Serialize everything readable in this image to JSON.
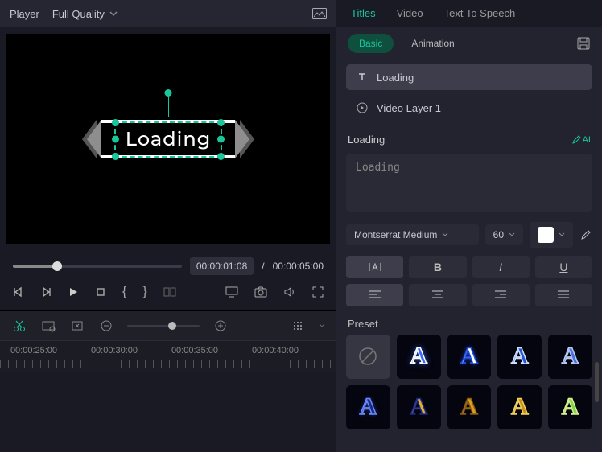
{
  "player": {
    "label": "Player",
    "quality": "Full Quality"
  },
  "preview": {
    "text": "Loading"
  },
  "transport": {
    "current": "00:00:01:08",
    "sep": "/",
    "duration": "00:00:05:00"
  },
  "ruler": {
    "marks": [
      "00:00:25:00",
      "00:00:30:00",
      "00:00:35:00",
      "00:00:40:00"
    ]
  },
  "tabs_top": {
    "titles": "Titles",
    "video": "Video",
    "tts": "Text To Speech"
  },
  "tabs_sub": {
    "basic": "Basic",
    "animation": "Animation"
  },
  "layers": {
    "title_layer": "Loading",
    "video_layer": "Video Layer 1"
  },
  "section": {
    "heading": "Loading",
    "ai": "AI"
  },
  "text_value": "Loading",
  "font": {
    "family": "Montserrat Medium",
    "size": "60"
  },
  "format": {
    "char_spacing": "|I|",
    "bold": "B",
    "italic": "I",
    "underline": "U"
  },
  "preset_label": "Preset",
  "preset_colors": [
    {
      "fill": "#3a6cff",
      "stroke": "#fff",
      "glow": "#3a6cff"
    },
    {
      "fill": "#fff",
      "stroke": "#1e4bdc",
      "glow": "#1e4bdc"
    },
    {
      "fill": "#2a52d6",
      "stroke": "#cfe0ff",
      "glow": "#344"
    },
    {
      "fill": "#4a6fe0",
      "stroke": "#b8c8f0",
      "glow": "#1a2a60"
    },
    {
      "fill": "#1a2a80",
      "stroke": "#6a8aff",
      "glow": "#2a3a90"
    },
    {
      "fill": "#e8b020",
      "stroke": "#1a2a90",
      "glow": "#1a2a90"
    },
    {
      "fill": "#d8a020",
      "stroke": "#8a5a10",
      "glow": "#3a2a00"
    },
    {
      "fill": "#c89018",
      "stroke": "#f0d060",
      "glow": "#5a4000"
    },
    {
      "fill": "#7ad84a",
      "stroke": "#d8f090",
      "glow": "#2a5010"
    }
  ]
}
